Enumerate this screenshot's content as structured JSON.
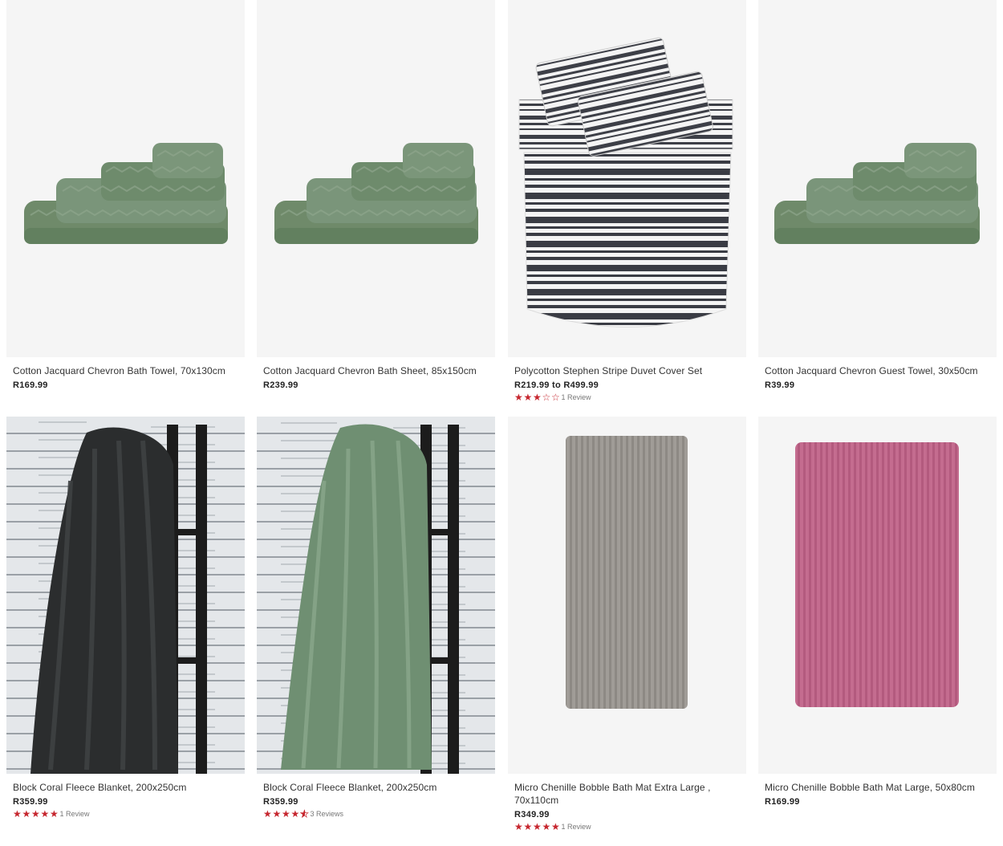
{
  "colors": {
    "star": "#c6262e",
    "image_bg": "#f5f5f5"
  },
  "products": [
    {
      "title": "Cotton Jacquard Chevron Bath Towel, 70x130cm",
      "price": "R169.99",
      "rating": null,
      "reviews": ""
    },
    {
      "title": "Cotton Jacquard Chevron Bath Sheet, 85x150cm",
      "price": "R239.99",
      "rating": null,
      "reviews": ""
    },
    {
      "title": "Polycotton Stephen Stripe Duvet Cover Set",
      "price": "R219.99 to R499.99",
      "rating": 3,
      "reviews": "1 Review"
    },
    {
      "title": "Cotton Jacquard Chevron Guest Towel, 30x50cm",
      "price": "R39.99",
      "rating": null,
      "reviews": ""
    },
    {
      "title": "Block Coral Fleece Blanket, 200x250cm",
      "price": "R359.99",
      "rating": 5,
      "reviews": "1 Review"
    },
    {
      "title": "Block Coral Fleece Blanket, 200x250cm",
      "price": "R359.99",
      "rating": 4.5,
      "reviews": "3 Reviews"
    },
    {
      "title": "Micro Chenille Bobble Bath Mat Extra Large , 70x110cm",
      "price": "R349.99",
      "rating": 5,
      "reviews": "1 Review"
    },
    {
      "title": "Micro Chenille Bobble Bath Mat Large, 50x80cm",
      "price": "R169.99",
      "rating": null,
      "reviews": ""
    }
  ]
}
